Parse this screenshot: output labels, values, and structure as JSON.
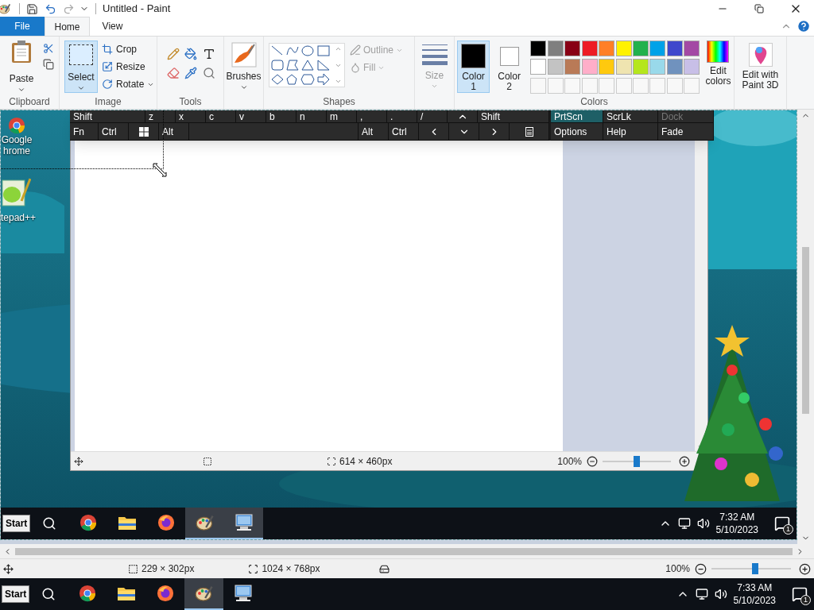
{
  "window": {
    "title": "Untitled - Paint"
  },
  "tabs": [
    {
      "label": "File",
      "selected": false,
      "kind": "file"
    },
    {
      "label": "Home",
      "selected": true,
      "kind": "tab"
    },
    {
      "label": "View",
      "selected": false,
      "kind": "tab"
    }
  ],
  "ribbon": {
    "clipboard": {
      "label": "Clipboard",
      "paste": "Paste"
    },
    "image": {
      "label": "Image",
      "select": {
        "label": "Select",
        "selected": true
      },
      "crop": "Crop",
      "resize": "Resize",
      "rotate": "Rotate"
    },
    "tools": {
      "label": "Tools"
    },
    "brushes": {
      "label": "Brushes"
    },
    "shapes": {
      "label": "Shapes",
      "outline": {
        "label": "Outline",
        "disabled": true
      },
      "fill": {
        "label": "Fill",
        "disabled": true
      }
    },
    "size": {
      "label": "Size",
      "disabled": true
    },
    "colors": {
      "label": "Colors",
      "color1": {
        "label": "Color 1",
        "color": "#000000",
        "selected": true
      },
      "color2": {
        "label": "Color 2",
        "color": "#ffffff",
        "selected": false
      },
      "palette": [
        {
          "color": "#000000"
        },
        {
          "color": "#7f7f7f"
        },
        {
          "color": "#880015"
        },
        {
          "color": "#ed1c24"
        },
        {
          "color": "#ff7f27"
        },
        {
          "color": "#fff200"
        },
        {
          "color": "#22b14c"
        },
        {
          "color": "#00a2e8"
        },
        {
          "color": "#3f48cc"
        },
        {
          "color": "#a349a4"
        },
        {
          "color": "#ffffff"
        },
        {
          "color": "#c3c3c3"
        },
        {
          "color": "#b97a57"
        },
        {
          "color": "#ffaec9"
        },
        {
          "color": "#ffc90e"
        },
        {
          "color": "#efe4b0"
        },
        {
          "color": "#b5e61d"
        },
        {
          "color": "#99d9ea"
        },
        {
          "color": "#7092be"
        },
        {
          "color": "#c8bfe7"
        }
      ],
      "edit": "Edit colors"
    },
    "paint3d": "Edit with Paint 3D"
  },
  "screenshot": {
    "desktop_icons": [
      {
        "kind": "chrome",
        "lines": [
          "Google",
          "hrome"
        ]
      },
      {
        "kind": "notepad",
        "lines": [
          "tepad++"
        ]
      }
    ],
    "keyboard": {
      "letter_row": [
        {
          "kind": "char",
          "label": "Shift"
        },
        {
          "kind": "char",
          "label": "z"
        },
        {
          "kind": "char",
          "label": "x"
        },
        {
          "kind": "char",
          "label": "c"
        },
        {
          "kind": "char",
          "label": "v"
        },
        {
          "kind": "char",
          "label": "b"
        },
        {
          "kind": "char",
          "label": "n"
        },
        {
          "kind": "char",
          "label": "m"
        },
        {
          "kind": "char",
          "label": ","
        },
        {
          "kind": "char",
          "label": "."
        },
        {
          "kind": "char",
          "label": "/"
        },
        {
          "kind": "up"
        },
        {
          "kind": "char",
          "label": "Shift"
        }
      ],
      "bottom_row": [
        {
          "kind": "char",
          "label": "Fn"
        },
        {
          "kind": "char",
          "label": "Ctrl"
        },
        {
          "kind": "windows"
        },
        {
          "kind": "char",
          "label": "Alt"
        },
        {
          "kind": "space"
        },
        {
          "kind": "char",
          "label": "Alt"
        },
        {
          "kind": "char",
          "label": "Ctrl"
        },
        {
          "kind": "left"
        },
        {
          "kind": "down"
        },
        {
          "kind": "right"
        },
        {
          "kind": "menu"
        }
      ],
      "side_panel": [
        {
          "kind": "char",
          "label": "PrtScn",
          "selected": true
        },
        {
          "kind": "char",
          "label": "ScrLk",
          "selected": false
        },
        {
          "kind": "char",
          "label": "Dock",
          "disabled": true
        },
        {
          "kind": "char",
          "label": "Options"
        },
        {
          "kind": "char",
          "label": "Help"
        },
        {
          "kind": "char",
          "label": "Fade",
          "disabled": false
        }
      ]
    },
    "paint_window": {
      "image_size": "614 × 460px",
      "zoom": "100%",
      "level": 0.5
    },
    "taskbar": {
      "start": "Start",
      "apps": [
        {
          "kind": "chrome",
          "active": false
        },
        {
          "kind": "folder",
          "active": false
        },
        {
          "kind": "firefox",
          "active": false
        },
        {
          "kind": "paint",
          "active": true
        },
        {
          "kind": "remote",
          "active": true
        }
      ],
      "time": "7:32 AM",
      "date": "5/10/2023",
      "notifications": "1"
    }
  },
  "status_bar": {
    "selection_size": "229 × 302px",
    "image_size": "1024 × 768px",
    "zoom": "100%",
    "level": 0.55
  },
  "taskbar": {
    "start": "Start",
    "apps": [
      {
        "kind": "chrome",
        "active": false
      },
      {
        "kind": "folder",
        "active": false
      },
      {
        "kind": "firefox",
        "active": false
      },
      {
        "kind": "paint",
        "active": true
      },
      {
        "kind": "remote",
        "active": false
      }
    ],
    "time": "7:33 AM",
    "date": "5/10/2023",
    "notifications": "1"
  }
}
